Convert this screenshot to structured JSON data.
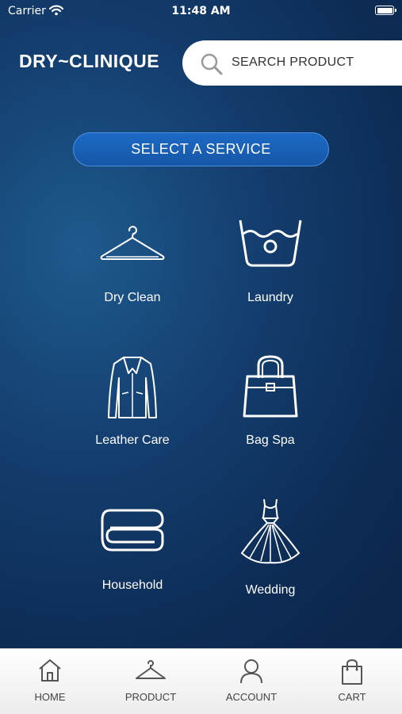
{
  "status_bar": {
    "carrier": "Carrier",
    "time": "11:48 AM"
  },
  "header": {
    "brand": "DRY~CLINIQUE",
    "search_placeholder": "SEARCH PRODUCT"
  },
  "select_service_label": "SELECT A SERVICE",
  "services": [
    {
      "label": "Dry Clean",
      "icon": "hanger-icon"
    },
    {
      "label": "Laundry",
      "icon": "wash-basin-icon"
    },
    {
      "label": "Leather Care",
      "icon": "leather-jacket-icon"
    },
    {
      "label": "Bag Spa",
      "icon": "handbag-icon"
    },
    {
      "label": "Household",
      "icon": "folded-towel-icon"
    },
    {
      "label": "Wedding",
      "icon": "wedding-dress-icon"
    }
  ],
  "tabbar": [
    {
      "label": "HOME",
      "icon": "home-icon"
    },
    {
      "label": "PRODUCT",
      "icon": "hanger-icon"
    },
    {
      "label": "ACCOUNT",
      "icon": "user-icon"
    },
    {
      "label": "CART",
      "icon": "shopping-bag-icon"
    }
  ],
  "colors": {
    "background": "#143f70",
    "button": "#1a63bb",
    "tabbar": "#f2f2f2"
  }
}
